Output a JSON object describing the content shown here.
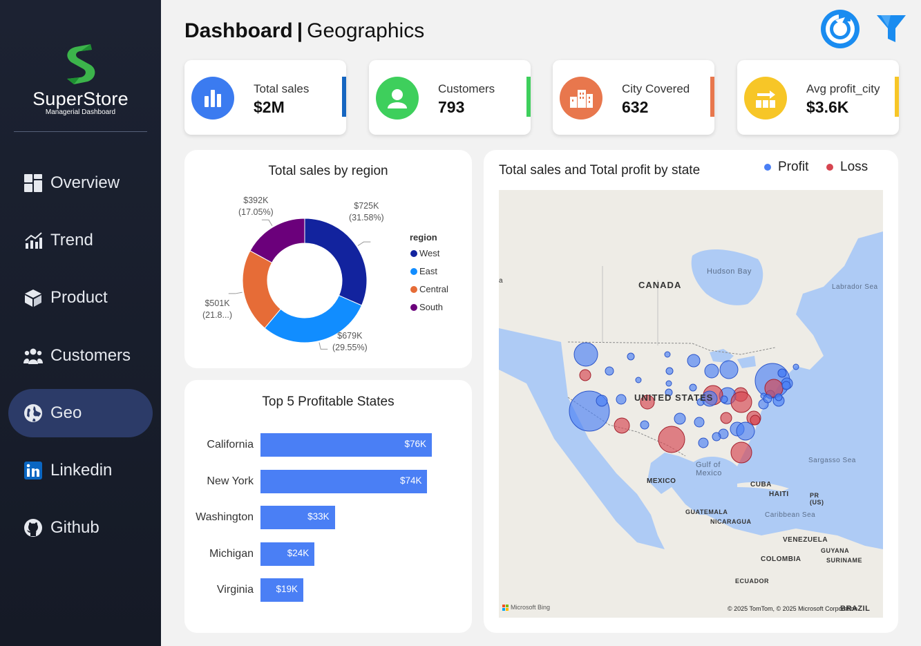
{
  "brand": {
    "title": "SuperStore",
    "subtitle": "Managerial Dashboard"
  },
  "nav": [
    {
      "label": "Overview",
      "icon": "grid-icon",
      "active": false
    },
    {
      "label": "Trend",
      "icon": "trend-chart-icon",
      "active": false
    },
    {
      "label": "Product",
      "icon": "box-icon",
      "active": false
    },
    {
      "label": "Customers",
      "icon": "users-icon",
      "active": false
    },
    {
      "label": "Geo",
      "icon": "globe-icon",
      "active": true
    },
    {
      "label": "Linkedin",
      "icon": "linkedin-icon",
      "active": false
    },
    {
      "label": "Github",
      "icon": "github-icon",
      "active": false
    }
  ],
  "header": {
    "title": "Dashboard",
    "separator": "|",
    "subtitle": "Geographics",
    "reset_icon": "reset-icon",
    "filter_icon": "filter-icon"
  },
  "kpis": [
    {
      "label": "Total sales",
      "value": "$2M",
      "icon": "bar-chart-icon",
      "color": "#3b7bf0",
      "bar_color": "#1565c0"
    },
    {
      "label": "Customers",
      "value": "793",
      "icon": "person-icon",
      "color": "#3ecf5c",
      "bar_color": "#3ecf5c"
    },
    {
      "label": "City Covered",
      "value": "632",
      "icon": "city-icon",
      "color": "#e8774d",
      "bar_color": "#e8774d"
    },
    {
      "label": "Avg profit_city",
      "value": "$3.6K",
      "icon": "profit-icon",
      "color": "#f7c627",
      "bar_color": "#f7c627"
    }
  ],
  "region_chart": {
    "title": "Total sales by region",
    "legend_title": "region",
    "chart_data": {
      "type": "pie",
      "categories": [
        "West",
        "East",
        "Central",
        "South"
      ],
      "values": [
        725,
        679,
        501,
        392
      ],
      "unit": "K",
      "labels": [
        {
          "value": "$725K",
          "pct": "(31.58%)"
        },
        {
          "value": "$679K",
          "pct": "(29.55%)"
        },
        {
          "value": "$501K",
          "pct": "(21.8...)"
        },
        {
          "value": "$392K",
          "pct": "(17.05%)"
        }
      ],
      "colors": [
        "#12239e",
        "#118dff",
        "#e66c37",
        "#6b007b"
      ]
    }
  },
  "top_states": {
    "title": "Top 5 Profitable States",
    "chart_data": {
      "type": "bar",
      "categories": [
        "California",
        "New York",
        "Washington",
        "Michigan",
        "Virginia"
      ],
      "values": [
        76,
        74,
        33,
        24,
        19
      ],
      "labels": [
        "$76K",
        "$74K",
        "$33K",
        "$24K",
        "$19K"
      ],
      "color": "#4a7ff5"
    }
  },
  "map": {
    "title": "Total sales and Total profit by state",
    "legend": [
      {
        "label": "Profit",
        "color": "#4a7ff5"
      },
      {
        "label": "Loss",
        "color": "#d64550"
      }
    ],
    "labels": {
      "canada": "CANADA",
      "hudson_bay": "Hudson Bay",
      "labrador_sea": "Labrador Sea",
      "united_states": "UNITED STATES",
      "gulf_of_mexico": "Gulf of\nMexico",
      "mexico": "MEXICO",
      "cuba": "CUBA",
      "haiti": "HAITI",
      "pr": "PR\n(US)",
      "sargasso_sea": "Sargasso Sea",
      "guatemala": "GUATEMALA",
      "nicaragua": "NICARAGUA",
      "caribbean_sea": "Caribbean Sea",
      "venezuela": "VENEZUELA",
      "guyana": "GUYANA",
      "suriname": "SURINAME",
      "colombia": "COLOMBIA",
      "ecuador": "ECUADOR",
      "brazil": "BRAZIL",
      "edge_a": "a"
    },
    "credit_left": "Microsoft Bing",
    "credit_right": "© 2025 TomTom, © 2025 Microsoft Corporation"
  }
}
